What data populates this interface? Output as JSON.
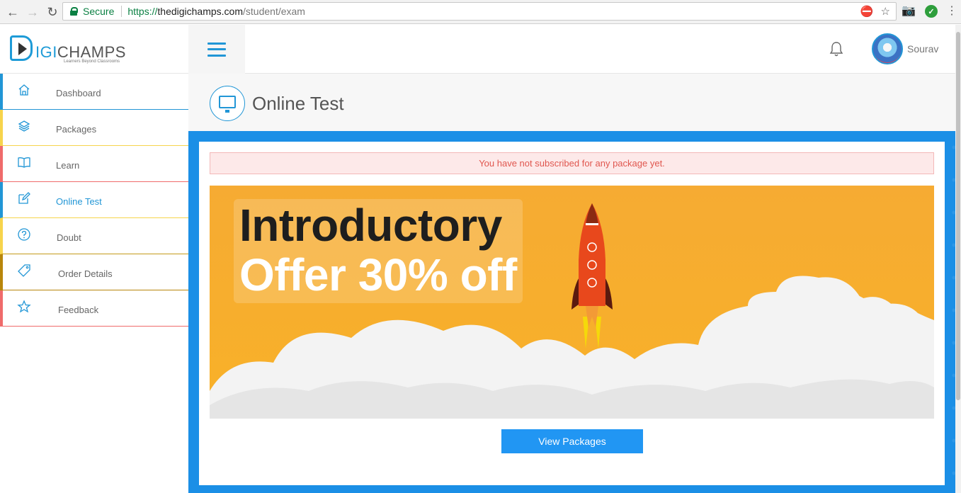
{
  "browser": {
    "secure_label": "Secure",
    "url_scheme": "https://",
    "url_host": "thedigichamps.com",
    "url_path": "/student/exam"
  },
  "header": {
    "logo_prefix": "D",
    "logo_igi": "IGI",
    "logo_rest": "CHAMPS",
    "logo_tagline": "Learners Beyond Classrooms",
    "user_name": "Sourav"
  },
  "sidebar": {
    "items": [
      {
        "label": "Dashboard",
        "icon": "home-icon",
        "color": "#2196d6"
      },
      {
        "label": "Packages",
        "icon": "layers-icon",
        "color": "#f7d44c"
      },
      {
        "label": "Learn",
        "icon": "book-icon",
        "color": "#ef6b6b"
      },
      {
        "label": "Online Test",
        "icon": "edit-icon",
        "color": "#2196d6"
      },
      {
        "label": "Doubt",
        "icon": "question-icon",
        "color": "#f7d44c"
      },
      {
        "label": "Order Details",
        "icon": "tag-icon",
        "color": "#b8860b"
      },
      {
        "label": "Feedback",
        "icon": "star-icon",
        "color": "#ef6b6b"
      }
    ]
  },
  "main": {
    "page_title": "Online Test",
    "alert": "You have not subscribed for any package yet.",
    "promo_line1": "Introductory",
    "promo_line2": "Offer 30% off",
    "view_packages_label": "View Packages"
  }
}
